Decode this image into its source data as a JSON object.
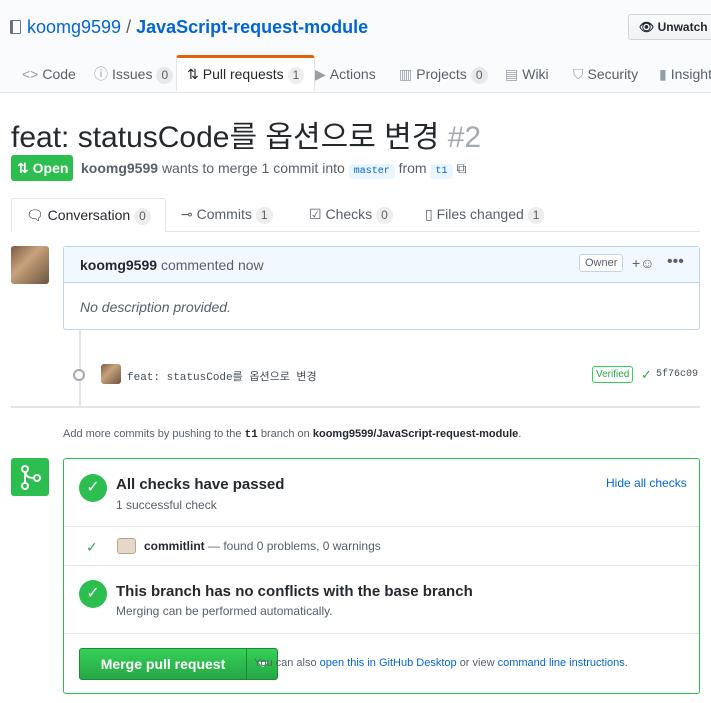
{
  "repo": {
    "owner": "koomg9599",
    "separator": "/",
    "name": "JavaScript-request-module"
  },
  "watch": {
    "label": "Unwatch"
  },
  "tabs": [
    {
      "label": "Code"
    },
    {
      "label": "Issues",
      "count": "0"
    },
    {
      "label": "Pull requests",
      "count": "1"
    },
    {
      "label": "Actions"
    },
    {
      "label": "Projects",
      "count": "0"
    },
    {
      "label": "Wiki"
    },
    {
      "label": "Security"
    },
    {
      "label": "Insights"
    }
  ],
  "pr": {
    "title": "feat: statusCode를 옵션으로 변경",
    "number": "#2",
    "state": "Open",
    "author": "koomg9599",
    "merge_text_1": "wants to merge 1 commit into",
    "base": "master",
    "from": "from",
    "head": "t1"
  },
  "prtabs": [
    {
      "label": "Conversation",
      "count": "0"
    },
    {
      "label": "Commits",
      "count": "1"
    },
    {
      "label": "Checks",
      "count": "0"
    },
    {
      "label": "Files changed",
      "count": "1"
    }
  ],
  "comment": {
    "author": "koomg9599",
    "action": "commented now",
    "badge": "Owner",
    "body": "No description provided."
  },
  "commit": {
    "message": "feat: statusCode를 옵션으로 변경",
    "verified": "Verified",
    "sha": "5f76c09"
  },
  "add_commits": {
    "prefix": "Add more commits by pushing to the",
    "branch": "t1",
    "middle": "branch on",
    "repo": "koomg9599/JavaScript-request-module",
    "suffix": "."
  },
  "checks": {
    "title": "All checks have passed",
    "subtitle": "1 successful check",
    "hide": "Hide all checks",
    "item_name": "commitlint",
    "item_desc": "— found 0 problems, 0 warnings"
  },
  "conflicts": {
    "title": "This branch has no conflicts with the base branch",
    "subtitle": "Merging can be performed automatically."
  },
  "merge": {
    "button": "Merge pull request",
    "also": "You can also",
    "desktop": "open this in GitHub Desktop",
    "or": "or view",
    "cli": "command line instructions",
    "end": "."
  },
  "colors": {
    "accent": "#0366d6",
    "success": "#2cbe4e",
    "tab_active": "#e36209"
  }
}
